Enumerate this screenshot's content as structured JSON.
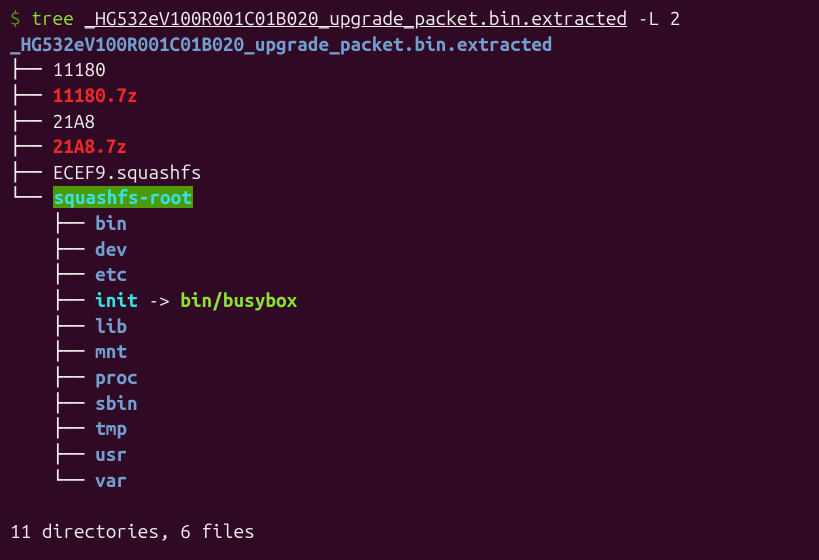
{
  "prompt": {
    "symbol": "$",
    "command": "tree",
    "argument": "_HG532eV100R001C01B020_upgrade_packet.bin.extracted",
    "flag": "-L 2"
  },
  "root_dir": "_HG532eV100R001C01B020_upgrade_packet.bin.extracted",
  "tree": {
    "items": [
      {
        "branch": "├── ",
        "name": "11180",
        "type": "file"
      },
      {
        "branch": "├── ",
        "name": "11180.7z",
        "type": "archive"
      },
      {
        "branch": "├── ",
        "name": "21A8",
        "type": "file"
      },
      {
        "branch": "├── ",
        "name": "21A8.7z",
        "type": "archive"
      },
      {
        "branch": "├── ",
        "name": "ECEF9.squashfs",
        "type": "file"
      },
      {
        "branch": "└── ",
        "name": "squashfs-root",
        "type": "dir-highlight"
      }
    ],
    "subtree": [
      {
        "branch": "    ├── ",
        "name": "bin",
        "type": "dir"
      },
      {
        "branch": "    ├── ",
        "name": "dev",
        "type": "dir"
      },
      {
        "branch": "    ├── ",
        "name": "etc",
        "type": "dir"
      },
      {
        "branch": "    ├── ",
        "name": "init",
        "type": "symlink",
        "arrow": " -> ",
        "target": "bin/busybox"
      },
      {
        "branch": "    ├── ",
        "name": "lib",
        "type": "dir"
      },
      {
        "branch": "    ├── ",
        "name": "mnt",
        "type": "dir"
      },
      {
        "branch": "    ├── ",
        "name": "proc",
        "type": "dir"
      },
      {
        "branch": "    ├── ",
        "name": "sbin",
        "type": "dir"
      },
      {
        "branch": "    ├── ",
        "name": "tmp",
        "type": "dir"
      },
      {
        "branch": "    ├── ",
        "name": "usr",
        "type": "dir"
      },
      {
        "branch": "    └── ",
        "name": "var",
        "type": "dir"
      }
    ]
  },
  "summary": "11 directories, 6 files"
}
